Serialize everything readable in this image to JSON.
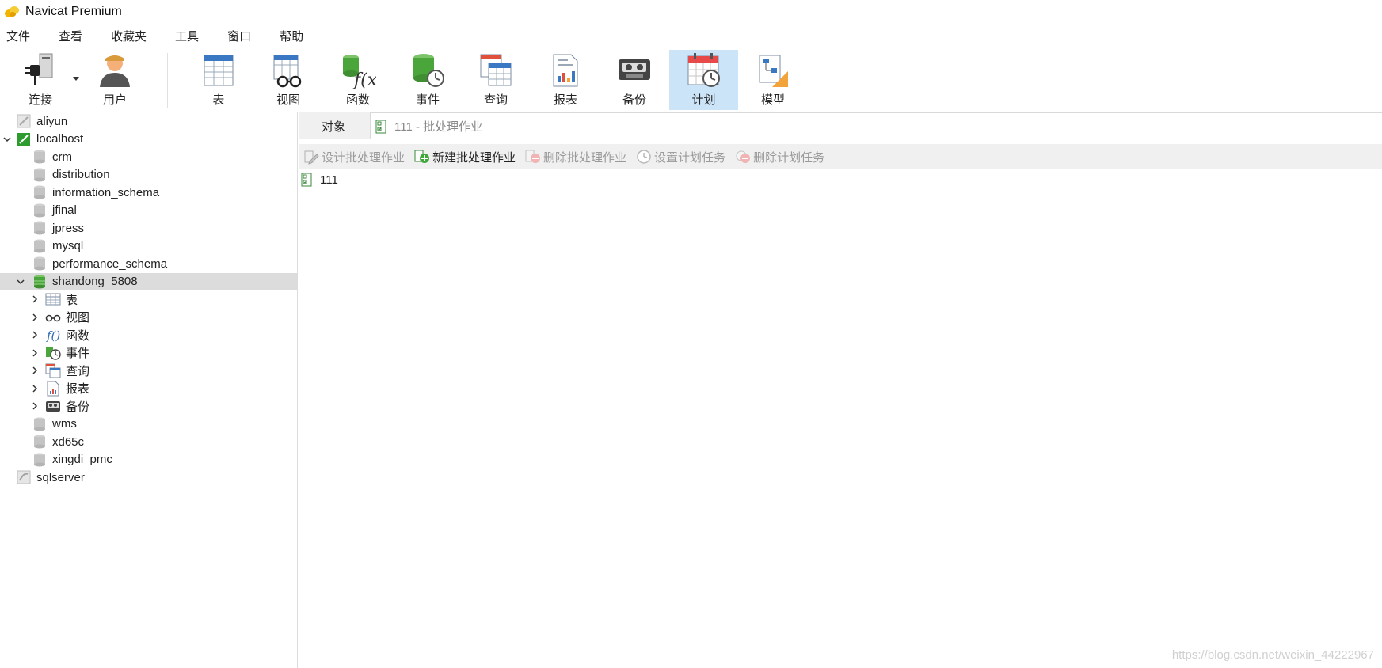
{
  "window": {
    "title": "Navicat Premium"
  },
  "menu": [
    "文件",
    "查看",
    "收藏夹",
    "工具",
    "窗口",
    "帮助"
  ],
  "toolbar": {
    "connect": "连接",
    "user": "用户",
    "table": "表",
    "view": "视图",
    "function": "函数",
    "event": "事件",
    "query": "查询",
    "report": "报表",
    "backup": "备份",
    "schedule": "计划",
    "model": "模型"
  },
  "tree": {
    "aliyun": "aliyun",
    "localhost": "localhost",
    "databases": [
      "crm",
      "distribution",
      "information_schema",
      "jfinal",
      "jpress",
      "mysql",
      "performance_schema"
    ],
    "selected_db": "shandong_5808",
    "children": [
      "表",
      "视图",
      "函数",
      "事件",
      "查询",
      "报表",
      "备份"
    ],
    "after": [
      "wms",
      "xd65c",
      "xingdi_pmc"
    ],
    "sqlserver": "sqlserver"
  },
  "tabs": {
    "objects": "对象",
    "job": "111 - 批处理作业"
  },
  "actions": {
    "design": "设计批处理作业",
    "new": "新建批处理作业",
    "delete": "删除批处理作业",
    "set_schedule": "设置计划任务",
    "delete_schedule": "删除计划任务"
  },
  "jobs": [
    "111"
  ],
  "watermark": "https://blog.csdn.net/weixin_44222967",
  "colors": {
    "selected_toolbar": "#cce4f7",
    "selected_tree": "#dcdcdc",
    "db_active": "#4caf50",
    "accent_red": "#e84a4a"
  }
}
